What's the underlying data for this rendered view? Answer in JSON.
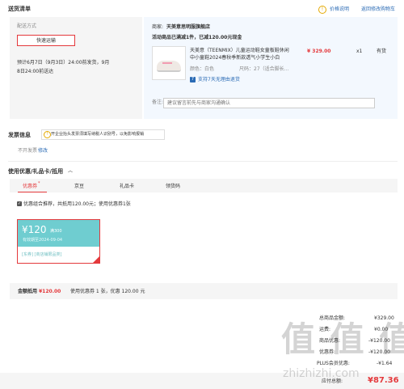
{
  "header": {
    "title": "送货清单",
    "price_help": "价格说明",
    "back_cart": "返回修改购物车"
  },
  "delivery": {
    "label": "配送方式",
    "method": "快速运输",
    "estimate": "预计6月7日（9月3日）24:00前发货，9月8日24:00前送达"
  },
  "shop": {
    "label": "商家:",
    "name": "天美意思明服旗舰店",
    "promo": "活动商品已满减1件，已减120.00元现金"
  },
  "product": {
    "title": "天美意（TEENMIX）儿童运动鞋女童板鞋休闲中小童鞋2024春秋季新款透气小学生小白",
    "price": "¥ 329.00",
    "qty": "x1",
    "stock": "有货",
    "color_label": "颜色：",
    "color": "白色",
    "size_label": "尺码：",
    "size": "27（适合脚长...",
    "return": "支持7天无理由退货"
  },
  "remark": {
    "label": "备注:",
    "placeholder": "建议留言前先与商家沟通确认"
  },
  "invoice": {
    "title": "发票信息",
    "notice": "开企业抬头发票须填写纳税人识别号，以免影响报销",
    "status": "不开发票",
    "edit": "修改"
  },
  "coupon": {
    "title": "使用优惠/礼品卡/抵用",
    "tabs": [
      {
        "label": "优惠券"
      },
      {
        "label": "京豆"
      },
      {
        "label": "礼品卡"
      },
      {
        "label": "领货码"
      }
    ],
    "recommend": "优惠组合推荐，共抵用120.00元；使用优惠券1张",
    "card": {
      "amount": "¥120",
      "cond": "满300",
      "expire": "有效期至2024-09-04",
      "scope": "[东券] [商店铺限品类]"
    },
    "summary_label": "金额抵用",
    "summary_amount": "¥120.00",
    "summary_detail": "使用优惠券 1 张，优惠 120.00 元"
  },
  "totals": {
    "rows": [
      {
        "label": "总商品金额:",
        "value": "¥329.00"
      },
      {
        "label": "运费:",
        "value": "¥0.00"
      },
      {
        "label": "商品优惠:",
        "value": "-¥120.00"
      },
      {
        "label": "优惠券:",
        "value": "-¥120.00"
      },
      {
        "label": "PLUS会员优惠:",
        "value": "-¥1.64"
      }
    ],
    "pay_label": "应付总额:",
    "pay_value": "¥87.36"
  },
  "watermark": {
    "text": "值 值 值",
    "site": "zhizhizhi.com"
  },
  "colors": {
    "accent": "#e4393c",
    "teal": "#6fcdd0",
    "panel": "#f3f8fe"
  }
}
